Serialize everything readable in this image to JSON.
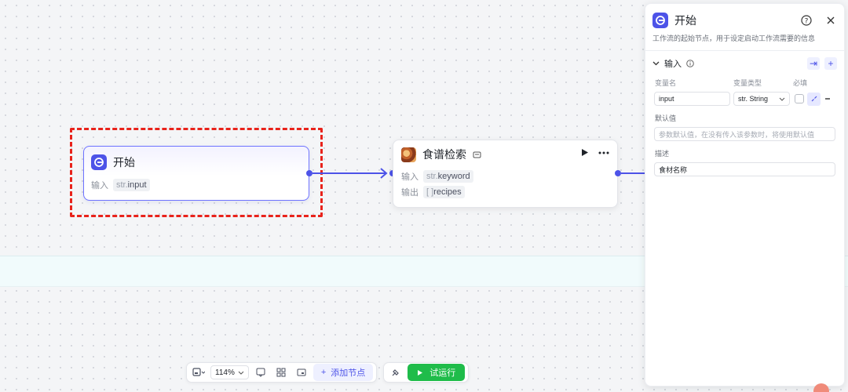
{
  "start_node": {
    "title": "开始",
    "input_label": "输入",
    "input_type": "str.",
    "input_name": "input"
  },
  "recipe_node": {
    "title": "食谱检索",
    "input_label": "输入",
    "input_type": "str.",
    "input_name": "keyword",
    "output_label": "输出",
    "output_type": "[ ]",
    "output_name": "recipes"
  },
  "panel": {
    "title": "开始",
    "description": "工作流的起始节点，用于设定启动工作流需要的信息",
    "section_title": "输入",
    "col_name": "变量名",
    "col_type": "变量类型",
    "col_required": "必填",
    "var_name": "input",
    "var_type": "str. String",
    "default_label": "默认值",
    "default_placeholder": "参数默认值，在没有传入该参数时，将使用默认值",
    "desc_label": "描述",
    "desc_value": "食材名称"
  },
  "toolbar": {
    "zoom": "114%",
    "add_node": "添加节点",
    "run": "试运行"
  },
  "colors": {
    "accent": "#4d53e8",
    "run_green": "#1fbc4a",
    "highlight_red": "#e8231b"
  }
}
